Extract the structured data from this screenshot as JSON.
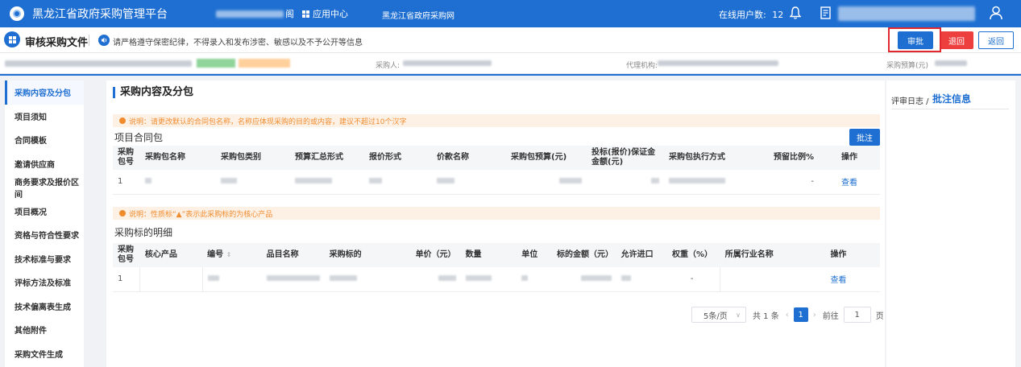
{
  "topbar": {
    "title": "黑龙江省政府采购管理平台",
    "nav_suffix": "阁",
    "app_center": "应用中心",
    "site_link": "黑龙江省政府采购网",
    "online_label": "在线用户数:",
    "online_count": "12"
  },
  "pagehead": {
    "title": "审核采购文件",
    "notice": "请严格遵守保密纪律，不得录入和发布涉密、敏感以及不予公开等信息",
    "approve": "审批",
    "return": "退回",
    "back": "返回"
  },
  "infostrip": {
    "buyer_label": "采购人:",
    "agency_label": "代理机构:",
    "budget_label": "采购预算(元)"
  },
  "sidebar": {
    "items": [
      {
        "label": "采购内容及分包"
      },
      {
        "label": "项目须知"
      },
      {
        "label": "合同模板"
      },
      {
        "label": "邀请供应商"
      },
      {
        "label": "商务要求及报价区间"
      },
      {
        "label": "项目概况"
      },
      {
        "label": "资格与符合性要求"
      },
      {
        "label": "技术标准与要求"
      },
      {
        "label": "评标方法及标准"
      },
      {
        "label": "技术偏离表生成"
      },
      {
        "label": "其他附件"
      },
      {
        "label": "采购文件生成"
      }
    ]
  },
  "main": {
    "section_title": "采购内容及分包",
    "tip1": "说明：请更改默认的合同包名称，名称应体现采购的目的或内容，建议不超过10个汉字",
    "package_title": "项目合同包",
    "annotate_btn": "批注",
    "package_headers": [
      "采购包号",
      "采购包名称",
      "采购包类别",
      "预算汇总形式",
      "报价形式",
      "价款名称",
      "采购包预算(元)",
      "投标(报价)保证金金额(元)",
      "采购包执行方式",
      "预留比例%",
      "操作"
    ],
    "package_row": {
      "no": "1",
      "reserve": "-",
      "action": "查看"
    },
    "tip2": "说明：性质标“▲”表示此采购标的为核心产品",
    "detail_title": "采购标的明细",
    "detail_headers": [
      "采购包号",
      "核心产品",
      "编号",
      "品目名称",
      "采购标的",
      "单价（元）",
      "数量",
      "单位",
      "标的金额（元）",
      "允许进口",
      "权重（%）",
      "所属行业名称",
      "操作"
    ],
    "detail_row": {
      "no": "1",
      "weight": "-",
      "action": "查看"
    }
  },
  "pager": {
    "page_size": "5条/页",
    "total": "共 1 条",
    "current": "1",
    "goto_label": "前往",
    "goto_value": "1",
    "page_unit": "页"
  },
  "rpanel": {
    "log": "评审日志 /",
    "info": "批注信息"
  }
}
